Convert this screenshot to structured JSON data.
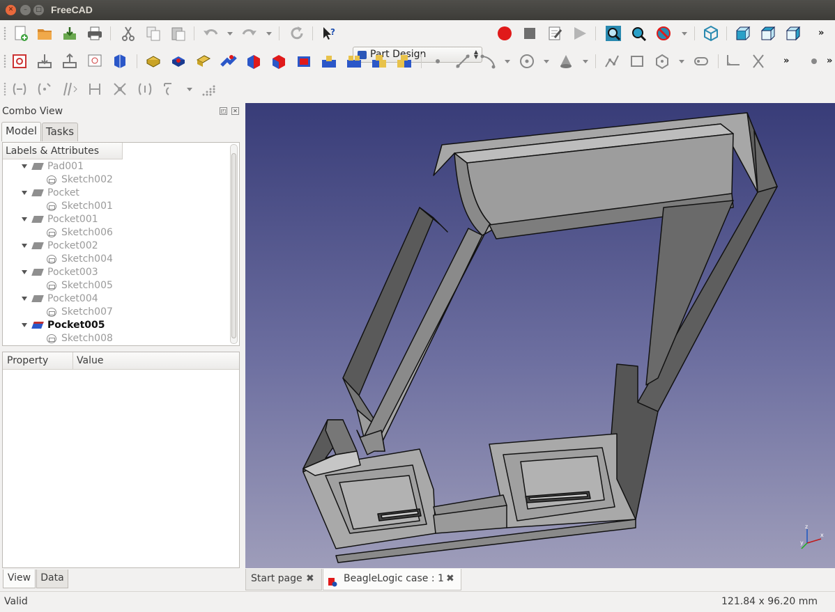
{
  "window": {
    "title": "FreeCAD"
  },
  "workbench": {
    "selected": "Part Design"
  },
  "combo_view": {
    "title": "Combo View",
    "tabs": [
      {
        "label": "Model"
      },
      {
        "label": "Tasks"
      }
    ],
    "tree_header": "Labels & Attributes",
    "tree": [
      {
        "label": "Pad001",
        "child": "Sketch002"
      },
      {
        "label": "Pocket",
        "child": "Sketch001"
      },
      {
        "label": "Pocket001",
        "child": "Sketch006"
      },
      {
        "label": "Pocket002",
        "child": "Sketch004"
      },
      {
        "label": "Pocket003",
        "child": "Sketch005"
      },
      {
        "label": "Pocket004",
        "child": "Sketch007"
      },
      {
        "label": "Pocket005",
        "child": "Sketch008"
      }
    ],
    "property_header": {
      "property": "Property",
      "value": "Value"
    },
    "bottom_tabs": [
      {
        "label": "View"
      },
      {
        "label": "Data"
      }
    ]
  },
  "document_tabs": [
    {
      "label": "Start page"
    },
    {
      "label": "BeagleLogic case : 1"
    }
  ],
  "status": {
    "message": "Valid",
    "dimensions": "121.84 x 96.20 mm"
  },
  "colors": {
    "viewport_top": "#383c78",
    "viewport_bottom": "#9e9dba",
    "model_face": "#a9a9a9",
    "selected_feature": "#2b57c8"
  },
  "toolbar_icons": [
    "new-file-icon",
    "open-file-icon",
    "save-icon",
    "print-icon",
    "cut-icon",
    "copy-icon",
    "paste-icon",
    "undo-icon",
    "redo-icon",
    "refresh-icon",
    "whats-this-icon",
    "macro-record-icon",
    "macro-stop-icon",
    "macro-edit-icon",
    "macro-run-icon",
    "fit-all-icon",
    "fit-selection-icon",
    "draw-style-icon",
    "isometric-view-icon",
    "front-view-icon",
    "top-view-icon",
    "right-view-icon"
  ]
}
